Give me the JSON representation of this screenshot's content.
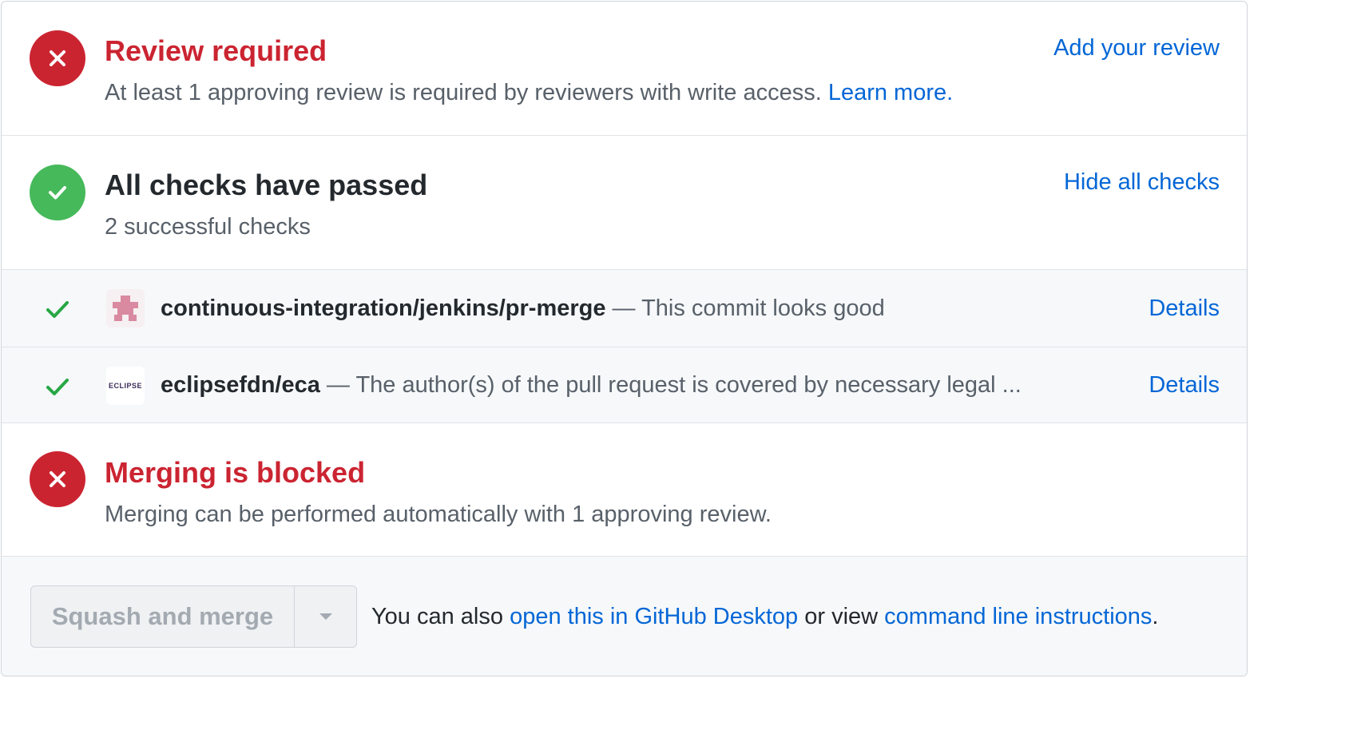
{
  "review": {
    "title": "Review required",
    "description": "At least 1 approving review is required by reviewers with write access.",
    "learn_more": "Learn more.",
    "action": "Add your review"
  },
  "checks": {
    "title": "All checks have passed",
    "summary": "2 successful checks",
    "action": "Hide all checks",
    "items": [
      {
        "name": "continuous-integration/jenkins/pr-merge",
        "separator": " — ",
        "description": "This commit looks good",
        "details": "Details",
        "avatar": "jenkins-avatar-icon"
      },
      {
        "name": "eclipsefdn/eca",
        "separator": " — ",
        "description": "The author(s) of the pull request is covered by necessary legal ...",
        "details": "Details",
        "avatar": "eclipse-avatar-icon",
        "avatar_text": "ECLIPSE"
      }
    ]
  },
  "blocked": {
    "title": "Merging is blocked",
    "description": "Merging can be performed automatically with 1 approving review."
  },
  "merge": {
    "button_label": "Squash and merge",
    "note_prefix": "You can also ",
    "desktop_link": "open this in GitHub Desktop",
    "note_middle": " or view ",
    "cli_link": "command line instructions",
    "note_suffix": "."
  },
  "colors": {
    "error": "#cb2431",
    "success": "#2cbe4e",
    "link": "#0366d6",
    "muted": "#586069"
  }
}
